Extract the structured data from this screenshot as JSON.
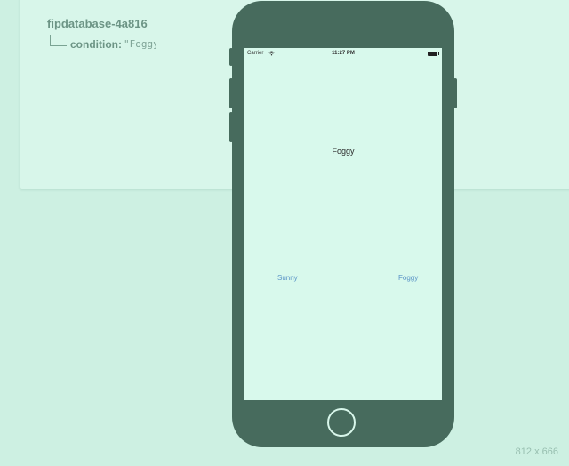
{
  "database": {
    "root": "fipdatabase-4a816",
    "child_key": "condition:",
    "child_value": "\"Foggy\""
  },
  "device": {
    "carrier": "Carrier",
    "time": "11:27 PM"
  },
  "app": {
    "condition_label": "Foggy",
    "sunny_button": "Sunny",
    "foggy_button": "Foggy"
  },
  "window": {
    "dimensions": "812 x 666"
  },
  "icons": {
    "wifi": "wifi-icon",
    "battery": "battery-icon",
    "home": "home-button"
  }
}
